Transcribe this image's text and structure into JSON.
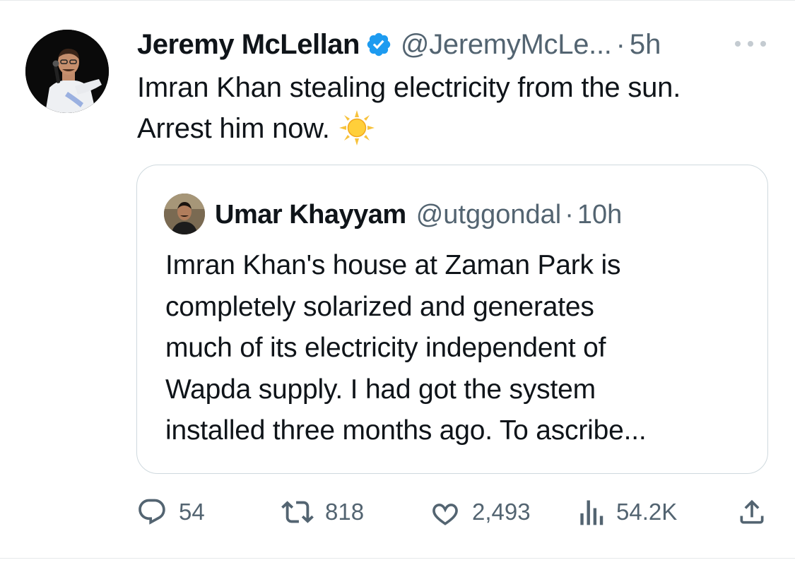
{
  "tweet": {
    "author_name": "Jeremy McLellan",
    "handle": "@JeremyMcLe...",
    "separator": "·",
    "time": "5h",
    "text_lines": [
      "Imran Khan stealing electricity from the sun.",
      "Arrest him now."
    ],
    "emoji": "sun-emoji",
    "verified_color": "#1d9bf0"
  },
  "quoted_tweet": {
    "author_name": "Umar Khayyam",
    "handle": "@utggondal",
    "separator": "·",
    "time": "10h",
    "text_lines": [
      "Imran Khan's house at Zaman Park is",
      "completely solarized and generates",
      "much of its electricity independent of",
      "Wapda supply. I had got the system",
      "installed three months ago. To ascribe..."
    ]
  },
  "actions": {
    "replies": "54",
    "reposts": "818",
    "likes": "2,493",
    "views": "54.2K",
    "icons": [
      "reply-icon",
      "repost-icon",
      "like-icon",
      "views-icon",
      "share-icon"
    ]
  },
  "colors": {
    "text": "#0f1419",
    "secondary": "#536471",
    "border": "#cfd9de"
  }
}
